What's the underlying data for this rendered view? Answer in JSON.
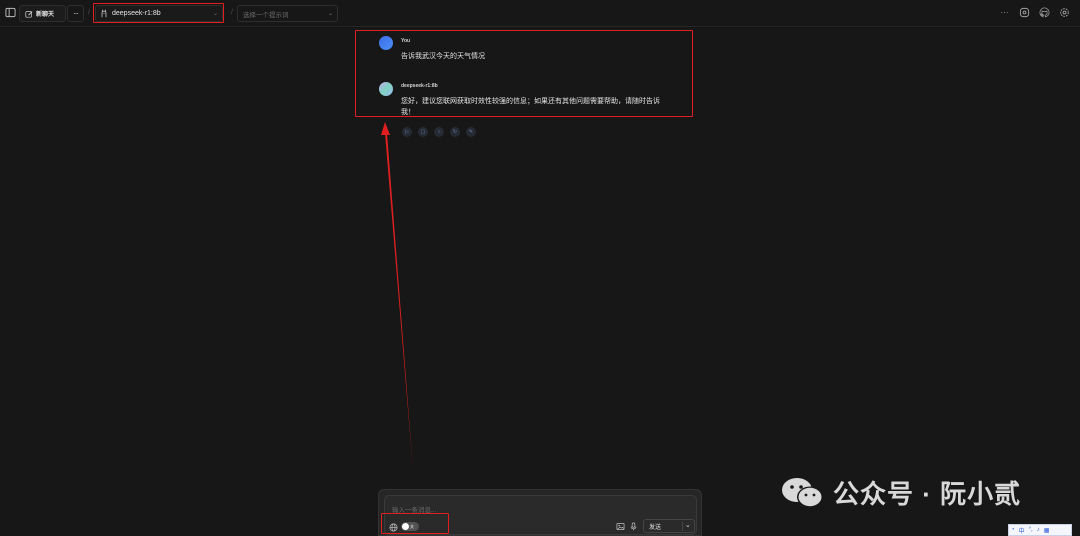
{
  "header": {
    "new_chat_label": "新聊天",
    "more_label": "···",
    "separator": "/",
    "model_name": "deepseek-r1:8b",
    "prompt_placeholder": "选择一个提示词"
  },
  "messages": [
    {
      "sender": "You",
      "text": "告诉我武汉今天的天气情况"
    },
    {
      "sender": "deepseek-r1:8b",
      "text": "您好，建议您联网获取时效性较强的信息；如果还有其他问题需要帮助，请随时告诉我！"
    }
  ],
  "composer": {
    "placeholder": "输入一条消息...",
    "web_search_state": "关",
    "send_label": "发送"
  },
  "watermark": {
    "text": "公众号 · 阮小贰"
  },
  "ime": {
    "lang": "中"
  },
  "colors": {
    "background": "#171717",
    "highlight": "#e02020",
    "user_avatar": "#3b82f6"
  }
}
